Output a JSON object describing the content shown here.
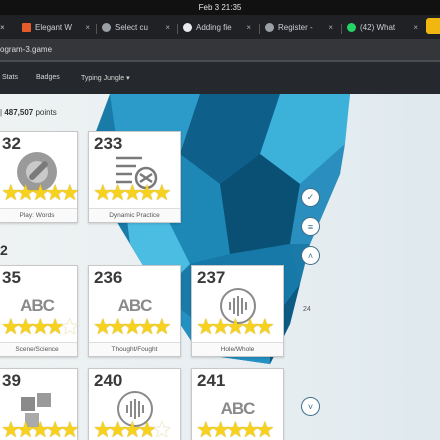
{
  "os": {
    "clock": "Feb 3  21:35"
  },
  "tabs": [
    {
      "label": "Elegant W",
      "icon": "flag-icon",
      "color": "#e45b2c"
    },
    {
      "label": "Select cu",
      "icon": "globe-icon",
      "color": "#9aa0a6"
    },
    {
      "label": "Adding fie",
      "icon": "github-icon",
      "color": "#e8eaed"
    },
    {
      "label": "Register -",
      "icon": "globe-icon",
      "color": "#9aa0a6"
    },
    {
      "label": "(42) What",
      "icon": "whatsapp-icon",
      "color": "#25d366"
    }
  ],
  "tab_close": "×",
  "url": "ogram-3.game",
  "nav": {
    "stats": "Stats",
    "badges": "Badges",
    "typing_jungle": "Typing Jungle ▾"
  },
  "points": {
    "prefix": "| ",
    "value": "487,507",
    "suffix": " points"
  },
  "sections": [
    {
      "num": "2"
    }
  ],
  "cards": [
    {
      "num": "32",
      "label": "Play: Words",
      "icon": "gear-wrench-icon",
      "stars": [
        "full",
        "full",
        "full",
        "full",
        "full"
      ]
    },
    {
      "num": "233",
      "label": "Dynamic Practice",
      "icon": "shuffle-list-icon",
      "stars": [
        "full",
        "full",
        "full",
        "full",
        "full"
      ]
    },
    {
      "num": "35",
      "label": "Scene/Science",
      "icon": "abc-eraser-icon",
      "icon_text": "ABC",
      "stars": [
        "full",
        "full",
        "full",
        "full",
        "empty"
      ]
    },
    {
      "num": "236",
      "label": "Thought/Fought",
      "icon": "abc-eraser-icon",
      "icon_text": "ABC",
      "stars": [
        "full",
        "full",
        "full",
        "full",
        "full"
      ]
    },
    {
      "num": "237",
      "label": "Hole/Whole",
      "icon": "sound-wave-icon",
      "stars": [
        "full",
        "full",
        "full",
        "full",
        "full"
      ]
    },
    {
      "num": "39",
      "label": "",
      "icon": "puzzle-icon",
      "stars": [
        "full",
        "full",
        "full",
        "full",
        "full"
      ]
    },
    {
      "num": "240",
      "label": "",
      "icon": "sound-wave-icon",
      "stars": [
        "full",
        "full",
        "full",
        "full",
        "empty"
      ]
    },
    {
      "num": "241",
      "label": "",
      "icon": "abc-eraser-icon",
      "icon_text": "ABC",
      "stars": [
        "full",
        "full",
        "full",
        "full",
        "full"
      ]
    }
  ],
  "side": {
    "num": "24"
  }
}
